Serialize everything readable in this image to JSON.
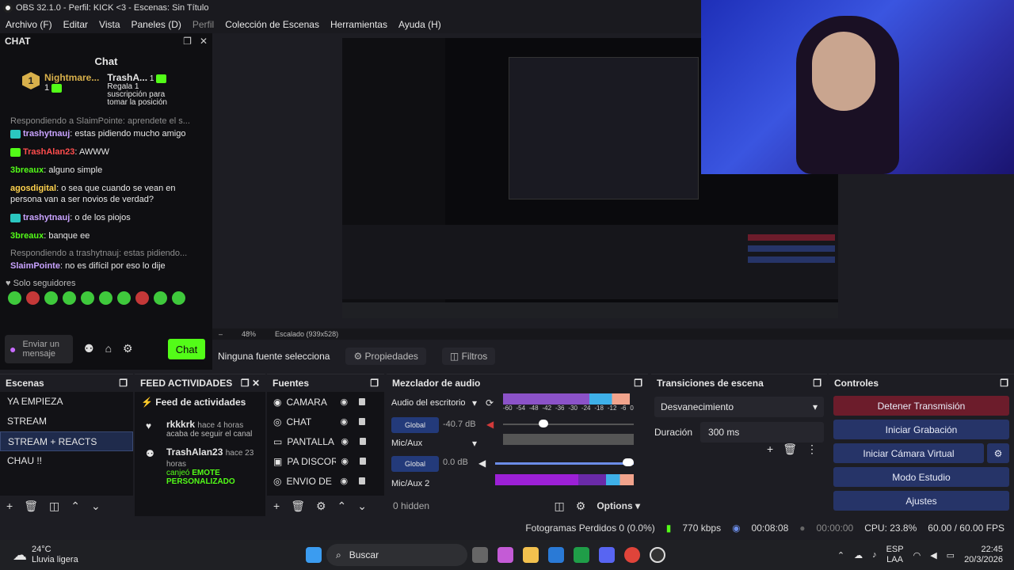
{
  "window": {
    "title": "OBS 32.1.0 - Perfil: KICK <3 - Escenas: Sin Título"
  },
  "menu": [
    "Archivo (F)",
    "Editar",
    "Vista",
    "Paneles (D)",
    "Perfil",
    "Colección de Escenas",
    "Herramientas",
    "Ayuda (H)"
  ],
  "chat": {
    "dock_title": "CHAT",
    "title": "Chat",
    "gift_user1": "Nightmare...",
    "gift_count1": "1",
    "gift_user2": "TrashA...",
    "gift_count2": "1",
    "gift_text": "Regala 1 suscripción para tomar la posición 3",
    "messages": [
      {
        "reply": "Respondiendo a SlaimPointe: aprendete el s...",
        "user": "trashytnauj",
        "text": "estas pidiendo mucho amigo",
        "color": "#c9a3ff",
        "icon": "t"
      },
      {
        "reply": "",
        "user": "TrashAlan23",
        "text": "AWWW",
        "color": "#ff4d4d",
        "icon": "g"
      },
      {
        "reply": "",
        "user": "3breaux",
        "text": "alguno simple",
        "color": "#53fc18",
        "icon": ""
      },
      {
        "reply": "",
        "user": "agosdigital",
        "text": "o sea que cuando se vean en persona van a ser novios de verdad?",
        "color": "#ffd24d",
        "icon": ""
      },
      {
        "reply": "",
        "user": "trashytnauj",
        "text": "o de los piojos",
        "color": "#c9a3ff",
        "icon": "t"
      },
      {
        "reply": "",
        "user": "3breaux",
        "text": "banque ee",
        "color": "#53fc18",
        "icon": ""
      },
      {
        "reply": "Respondiendo a trashytnauj: estas pidiendo...",
        "user": "SlaimPointe",
        "text": "no es difícil por eso lo dije",
        "color": "#c9a3ff",
        "icon": ""
      }
    ],
    "followers": "Solo seguidores",
    "input_placeholder": "Enviar un mensaje",
    "send_label": "Chat"
  },
  "zoom": {
    "percent": "48%",
    "scaling": "Escalado (939x528)"
  },
  "source_bar": {
    "none": "Ninguna fuente selecciona",
    "props": "Propiedades",
    "filters": "Filtros"
  },
  "scenes": {
    "title": "Escenas",
    "items": [
      "YA EMPIEZA",
      "STREAM",
      "STREAM + REACTS",
      "CHAU !!"
    ],
    "selected": 2
  },
  "feed": {
    "title": "FEED ACTIVIDADES",
    "heading": "Feed de actividades",
    "items": [
      {
        "user": "rkkkrk",
        "time": "hace 4 horas",
        "text": "acaba de seguir el canal",
        "highlight": ""
      },
      {
        "user": "TrashAlan23",
        "time": "hace 23 horas",
        "text": "canjeó",
        "highlight": "EMOTE PERSONALIZADO"
      }
    ]
  },
  "sources": {
    "title": "Fuentes",
    "items": [
      "CAMARA",
      "CHAT",
      "PANTALLA",
      "PA DISCORD",
      "ENVIO DE KI"
    ]
  },
  "mixer": {
    "title": "Mezclador de audio",
    "channels": [
      {
        "name": "Audio del escritorio",
        "db": "-40.7 dB",
        "level": 0.32,
        "muted": true
      },
      {
        "name": "Mic/Aux",
        "db": "0.0 dB",
        "level": 1.0,
        "muted": false
      },
      {
        "name": "Mic/Aux 2",
        "db": "",
        "level": 0,
        "muted": false
      }
    ],
    "global_label": "Global",
    "scale": [
      "-60",
      "-54",
      "-48",
      "-42",
      "-36",
      "-30",
      "-24",
      "-18",
      "-12",
      "-6",
      "0"
    ],
    "hidden": "0 hidden",
    "options": "Options"
  },
  "transitions": {
    "title": "Transiciones de escena",
    "type": "Desvanecimiento",
    "duration_label": "Duración",
    "duration": "300 ms"
  },
  "controls": {
    "title": "Controles",
    "buttons": [
      "Detener Transmisión",
      "Iniciar Grabación",
      "Iniciar Cámara Virtual",
      "Modo Estudio",
      "Ajustes"
    ]
  },
  "status": {
    "dropped": "Fotogramas Perdidos 0 (0.0%)",
    "kbps": "770 kbps",
    "stream_time": "00:08:08",
    "rec_time": "00:00:00",
    "cpu": "CPU: 23.8%",
    "fps": "60.00 / 60.00 FPS"
  },
  "taskbar": {
    "temp": "24°C",
    "weather": "Lluvia ligera",
    "search": "Buscar",
    "lang1": "ESP",
    "lang2": "LAA",
    "time": "22:45",
    "date": "20/3/2026"
  },
  "colors": {
    "kick_green": "#53fc18",
    "stop_red": "#6c1c2b",
    "ctrl_blue": "#263468"
  }
}
